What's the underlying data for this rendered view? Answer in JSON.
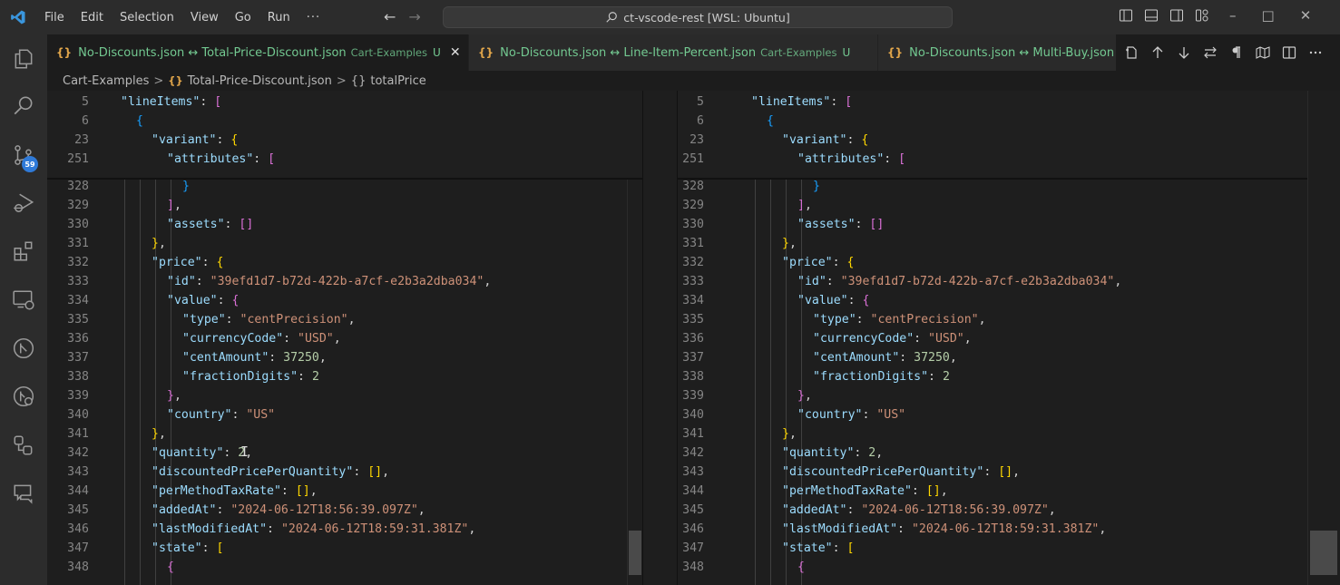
{
  "titlebar": {
    "menu": [
      "File",
      "Edit",
      "Selection",
      "View",
      "Go",
      "Run",
      "···"
    ],
    "search": "ct-vscode-rest [WSL: Ubuntu]",
    "back_icon": "←",
    "forward_icon": "→",
    "minimize": "–",
    "maximize": "□",
    "close": "✕"
  },
  "activity_bar": {
    "items": [
      "explorer",
      "search",
      "source-control",
      "run-debug",
      "extensions",
      "remote-explorer",
      "git-graph",
      "gitlens",
      "accounts-tree",
      "chat"
    ],
    "source_control_badge": "59"
  },
  "tabs": [
    {
      "braces": "{}",
      "name": "No-Discounts.json ↔ Total-Price-Discount.json",
      "desc": "Cart-Examples",
      "status": "U",
      "active": true,
      "close": "✕"
    },
    {
      "braces": "{}",
      "name": "No-Discounts.json ↔ Line-Item-Percent.json",
      "desc": "Cart-Examples",
      "status": "U",
      "active": false
    },
    {
      "braces": "{}",
      "name": "No-Discounts.json ↔ Multi-Buy.json",
      "desc": "",
      "status": "",
      "active": false
    }
  ],
  "editor_actions": [
    "open-file",
    "previous-change",
    "next-change",
    "swap",
    "show-whitespace",
    "map",
    "split-editor",
    "more"
  ],
  "breadcrumb": {
    "folder": "Cart-Examples",
    "sep": ">",
    "file_braces": "{}",
    "file": "Total-Price-Discount.json",
    "symbol_icon": "{}",
    "symbol": "totalPrice"
  },
  "editor": {
    "sticky_lines": [
      {
        "num": "5",
        "indent": 0,
        "tokens": [
          [
            "k",
            "\"lineItems\""
          ],
          [
            "p",
            ": "
          ],
          [
            "b2",
            "["
          ]
        ]
      },
      {
        "num": "6",
        "indent": 1,
        "tokens": [
          [
            "b3",
            "{"
          ]
        ]
      },
      {
        "num": "23",
        "indent": 2,
        "tokens": [
          [
            "k",
            "\"variant\""
          ],
          [
            "p",
            ": "
          ],
          [
            "b1",
            "{"
          ]
        ]
      },
      {
        "num": "251",
        "indent": 3,
        "tokens": [
          [
            "k",
            "\"attributes\""
          ],
          [
            "p",
            ": "
          ],
          [
            "b2",
            "["
          ]
        ]
      }
    ],
    "lines": [
      {
        "num": "328",
        "indent": 4,
        "tokens": [
          [
            "b3",
            "}"
          ]
        ]
      },
      {
        "num": "329",
        "indent": 3,
        "tokens": [
          [
            "b2",
            "]"
          ],
          [
            "p",
            ","
          ]
        ]
      },
      {
        "num": "330",
        "indent": 3,
        "tokens": [
          [
            "k",
            "\"assets\""
          ],
          [
            "p",
            ": "
          ],
          [
            "b2",
            "[]"
          ]
        ]
      },
      {
        "num": "331",
        "indent": 2,
        "tokens": [
          [
            "b1",
            "}"
          ],
          [
            "p",
            ","
          ]
        ]
      },
      {
        "num": "332",
        "indent": 2,
        "tokens": [
          [
            "k",
            "\"price\""
          ],
          [
            "p",
            ": "
          ],
          [
            "b1",
            "{"
          ]
        ]
      },
      {
        "num": "333",
        "indent": 3,
        "tokens": [
          [
            "k",
            "\"id\""
          ],
          [
            "p",
            ": "
          ],
          [
            "s",
            "\"39efd1d7-b72d-422b-a7cf-e2b3a2dba034\""
          ],
          [
            "p",
            ","
          ]
        ]
      },
      {
        "num": "334",
        "indent": 3,
        "tokens": [
          [
            "k",
            "\"value\""
          ],
          [
            "p",
            ": "
          ],
          [
            "b2",
            "{"
          ]
        ]
      },
      {
        "num": "335",
        "indent": 4,
        "tokens": [
          [
            "k",
            "\"type\""
          ],
          [
            "p",
            ": "
          ],
          [
            "s",
            "\"centPrecision\""
          ],
          [
            "p",
            ","
          ]
        ]
      },
      {
        "num": "336",
        "indent": 4,
        "tokens": [
          [
            "k",
            "\"currencyCode\""
          ],
          [
            "p",
            ": "
          ],
          [
            "s",
            "\"USD\""
          ],
          [
            "p",
            ","
          ]
        ]
      },
      {
        "num": "337",
        "indent": 4,
        "tokens": [
          [
            "k",
            "\"centAmount\""
          ],
          [
            "p",
            ": "
          ],
          [
            "n",
            "37250"
          ],
          [
            "p",
            ","
          ]
        ]
      },
      {
        "num": "338",
        "indent": 4,
        "tokens": [
          [
            "k",
            "\"fractionDigits\""
          ],
          [
            "p",
            ": "
          ],
          [
            "n",
            "2"
          ]
        ]
      },
      {
        "num": "339",
        "indent": 3,
        "tokens": [
          [
            "b2",
            "}"
          ],
          [
            "p",
            ","
          ]
        ]
      },
      {
        "num": "340",
        "indent": 3,
        "tokens": [
          [
            "k",
            "\"country\""
          ],
          [
            "p",
            ": "
          ],
          [
            "s",
            "\"US\""
          ]
        ]
      },
      {
        "num": "341",
        "indent": 2,
        "tokens": [
          [
            "b1",
            "}"
          ],
          [
            "p",
            ","
          ]
        ]
      },
      {
        "num": "342",
        "indent": 2,
        "tokens": [
          [
            "k",
            "\"quantity\""
          ],
          [
            "p",
            ": "
          ],
          [
            "n",
            "2"
          ],
          [
            "p",
            ","
          ]
        ]
      },
      {
        "num": "343",
        "indent": 2,
        "tokens": [
          [
            "k",
            "\"discountedPricePerQuantity\""
          ],
          [
            "p",
            ": "
          ],
          [
            "b1",
            "[]"
          ],
          [
            "p",
            ","
          ]
        ]
      },
      {
        "num": "344",
        "indent": 2,
        "tokens": [
          [
            "k",
            "\"perMethodTaxRate\""
          ],
          [
            "p",
            ": "
          ],
          [
            "b1",
            "[]"
          ],
          [
            "p",
            ","
          ]
        ]
      },
      {
        "num": "345",
        "indent": 2,
        "tokens": [
          [
            "k",
            "\"addedAt\""
          ],
          [
            "p",
            ": "
          ],
          [
            "s",
            "\"2024-06-12T18:56:39.097Z\""
          ],
          [
            "p",
            ","
          ]
        ]
      },
      {
        "num": "346",
        "indent": 2,
        "tokens": [
          [
            "k",
            "\"lastModifiedAt\""
          ],
          [
            "p",
            ": "
          ],
          [
            "s",
            "\"2024-06-12T18:59:31.381Z\""
          ],
          [
            "p",
            ","
          ]
        ]
      },
      {
        "num": "347",
        "indent": 2,
        "tokens": [
          [
            "k",
            "\"state\""
          ],
          [
            "p",
            ": "
          ],
          [
            "b1",
            "["
          ]
        ]
      },
      {
        "num": "348",
        "indent": 3,
        "tokens": [
          [
            "b2",
            "{"
          ]
        ]
      }
    ]
  },
  "scroll": {
    "left_thumb_fraction_start": 0.89,
    "left_thumb_fraction_size": 0.09,
    "right_thumb_fraction_start": 0.89,
    "right_thumb_fraction_size": 0.09
  }
}
